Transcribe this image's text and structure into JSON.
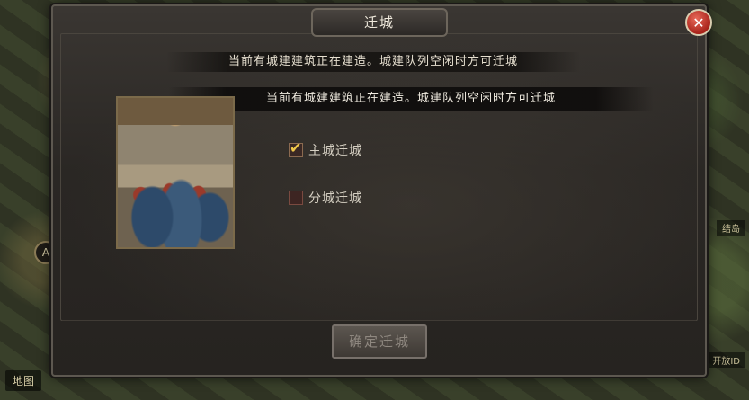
{
  "map": {
    "bottom_label": "地图",
    "round_badge": "A",
    "tag_right": "结岛",
    "tag_right2": "开放ID"
  },
  "ticker": {
    "text": "当前有城建建筑正在建造。城建队列空闲时方可迁城"
  },
  "dialog": {
    "title": "迁城",
    "close_symbol": "✕",
    "notice": "当前有城建建筑正在建造。城建队列空闲时方可迁城",
    "options": [
      {
        "label": "主城迁城",
        "checked": true
      },
      {
        "label": "分城迁城",
        "checked": false
      }
    ],
    "confirm_label": "确定迁城"
  }
}
